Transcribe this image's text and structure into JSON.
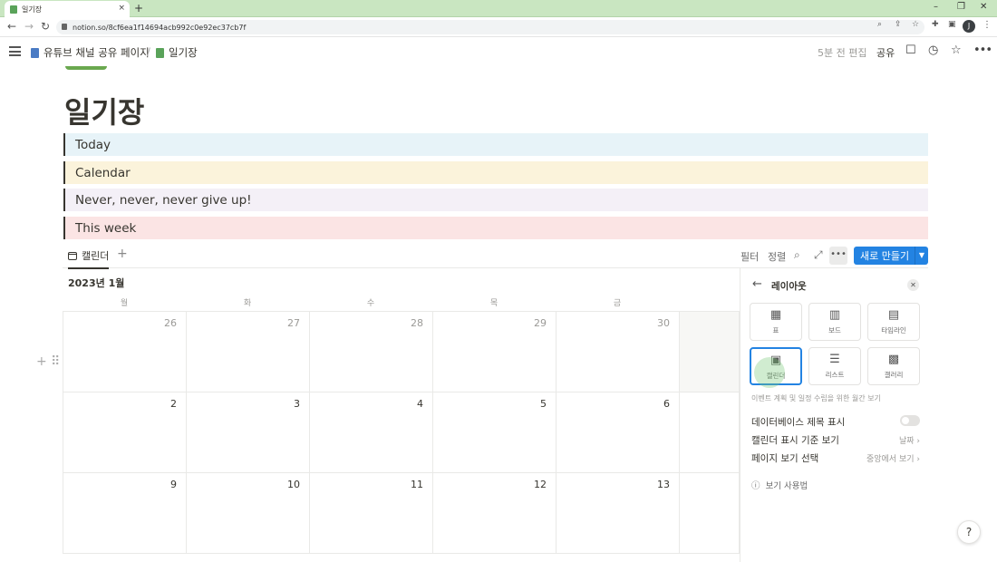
{
  "browser": {
    "tab_title": "일기장",
    "tab_close": "×",
    "new_tab": "+",
    "url": "notion.so/8cf6ea1f14694acb992c0e92ec37cb7f",
    "profile_initial": "J"
  },
  "topbar": {
    "breadcrumb_parent": "유튜브 채널 공유 페이지",
    "breadcrumb_sep": "/",
    "breadcrumb_current": "일기장",
    "edited": "5분 전 편집",
    "share": "공유"
  },
  "page": {
    "title": "일기장",
    "callouts": [
      {
        "label": "Today",
        "bg": "#e7f3f8"
      },
      {
        "label": "Calendar",
        "bg": "#fbf3db"
      },
      {
        "label": "Never, never, never give up!",
        "bg": "#f4f0f7"
      },
      {
        "label": "This week",
        "bg": "#fbe4e4"
      }
    ]
  },
  "view": {
    "tab_label": "캘린더",
    "add": "+",
    "filter": "필터",
    "sort": "정렬",
    "new_button": "새로 만들기"
  },
  "calendar": {
    "month": "2023년 1월",
    "weekdays": [
      "월",
      "화",
      "수",
      "목",
      "금"
    ],
    "weeks": [
      [
        "26",
        "27",
        "28",
        "29",
        "30"
      ],
      [
        "2",
        "3",
        "4",
        "5",
        "6"
      ],
      [
        "9",
        "10",
        "11",
        "12",
        "13"
      ]
    ]
  },
  "layout_panel": {
    "title": "레이아웃",
    "layouts": [
      {
        "name": "표",
        "icon": "table-icon"
      },
      {
        "name": "보드",
        "icon": "board-icon"
      },
      {
        "name": "타임라인",
        "icon": "timeline-icon"
      },
      {
        "name": "캘린더",
        "icon": "calendar-icon",
        "selected": true
      },
      {
        "name": "리스트",
        "icon": "list-icon"
      },
      {
        "name": "갤러리",
        "icon": "gallery-icon"
      }
    ],
    "description": "이벤트 계획 및 일정 수립을 위한 월간 보기",
    "show_db_title": "데이터베이스 제목 표시",
    "show_by": "캘린더 표시 기준 보기",
    "show_by_value": "날짜",
    "page_view": "페이지 보기 선택",
    "page_view_value": "중앙에서 보기",
    "help": "보기 사용법"
  },
  "help_button": "?"
}
